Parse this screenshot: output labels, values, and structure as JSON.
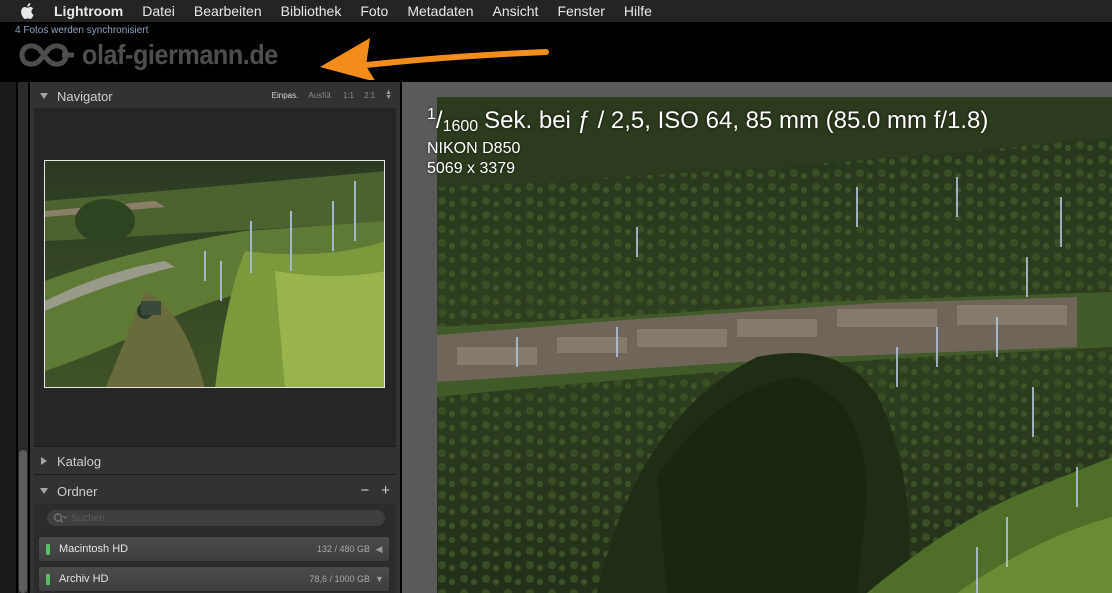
{
  "menubar": {
    "app_name": "Lightroom",
    "items": [
      "Datei",
      "Bearbeiten",
      "Bibliothek",
      "Foto",
      "Metadaten",
      "Ansicht",
      "Fenster",
      "Hilfe"
    ]
  },
  "header": {
    "sync_status": "4 Fotos werden synchronisiert",
    "logo_text": "olaf-giermann.de",
    "arrow_color": "#f28c1b"
  },
  "navigator": {
    "title": "Navigator",
    "zoom_options": [
      "Einpas.",
      "Ausfül.",
      "1:1",
      "2:1"
    ],
    "active_zoom": "Einpas."
  },
  "katalog": {
    "title": "Katalog"
  },
  "ordner": {
    "title": "Ordner",
    "remove_label": "−",
    "add_label": "+",
    "search_placeholder": "Suchen",
    "volumes": [
      {
        "name": "Macintosh HD",
        "size": "132 / 480 GB",
        "indicator": "◀"
      },
      {
        "name": "Archiv HD",
        "size": "78,6 / 1000 GB",
        "indicator": "▼"
      }
    ]
  },
  "photo_info": {
    "shutter_num": "1",
    "shutter_den": "1600",
    "exif_rest": "Sek. bei ƒ / 2,5, ISO 64, 85 mm (85.0 mm f/1.8)",
    "camera": "NIKON D850",
    "dimensions": "5069 x 3379"
  },
  "colors": {
    "panel_bg": "#323232",
    "accent_green": "#54c25e",
    "main_bg": "#5a5a5a"
  }
}
